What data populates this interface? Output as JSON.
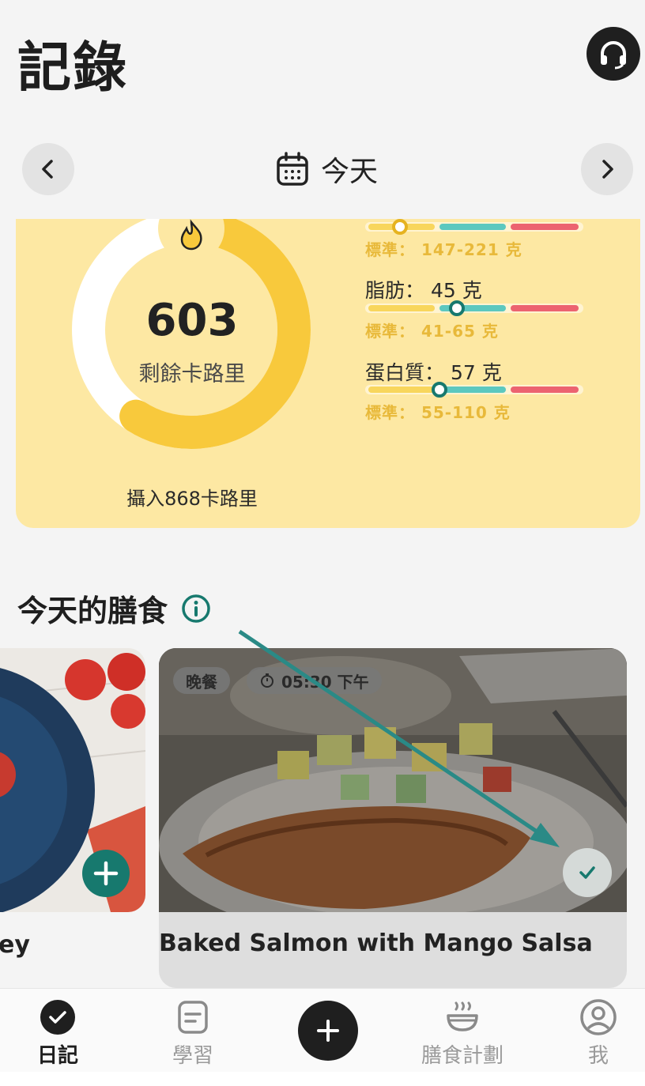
{
  "header": {
    "title": "記錄"
  },
  "date_nav": {
    "label": "今天"
  },
  "summary": {
    "remaining_value": "603",
    "remaining_label": "剩餘卡路里",
    "intake_text": "攝入868卡路里",
    "macros": [
      {
        "label": "",
        "standard": "標準： 147-221 克",
        "level": 0.16
      },
      {
        "label": "脂肪： 45 克",
        "standard": "標準： 41-65 克",
        "level": 0.42
      },
      {
        "label": "蛋白質： 57 克",
        "standard": "標準： 55-110 克",
        "level": 0.34
      }
    ]
  },
  "meals_section": {
    "title": "今天的膳食",
    "cards": [
      {
        "name": "ey"
      },
      {
        "name": "Baked Salmon with Mango Salsa",
        "tag_meal": "晚餐",
        "tag_time": "05:30 下午"
      }
    ]
  },
  "tabbar": {
    "items": [
      {
        "label": "日記",
        "active": true
      },
      {
        "label": "學習"
      },
      {
        "label": "膳食計劃"
      },
      {
        "label": "我"
      }
    ]
  },
  "colors": {
    "accent_yellow": "#f8c93c",
    "card_bg": "#fde8a3",
    "teal": "#17796e",
    "red": "#ec6370"
  }
}
